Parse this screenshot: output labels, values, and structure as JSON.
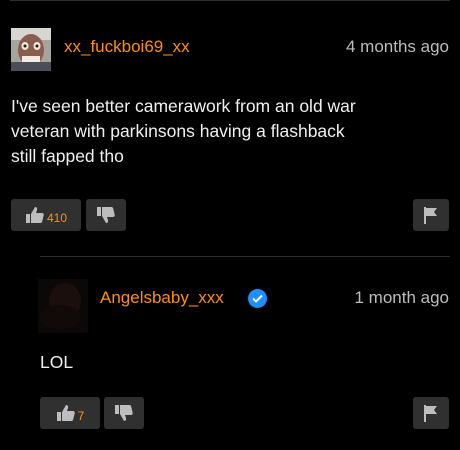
{
  "comments": [
    {
      "username": "xx_fuckboi69_xx",
      "timestamp": "4 months ago",
      "text": [
        "I've seen better camerawork from an old war",
        "veteran with parkinsons having a flashback",
        "still fapped tho"
      ],
      "likes": "410",
      "verified": false
    },
    {
      "username": "Angelsbaby_xxx",
      "timestamp": "1 month ago",
      "text": [
        "LOL"
      ],
      "likes": "7",
      "verified": true
    }
  ],
  "icons": {
    "like": "thumbs-up-icon",
    "dislike": "thumbs-down-icon",
    "report": "flag-icon",
    "verified": "verified-check-icon"
  },
  "colors": {
    "background": "#000000",
    "username": "#ff9000",
    "like_count": "#ff9000",
    "button": "#303030",
    "verified_badge": "#1d8fff",
    "timestamp": "#bdbdbd"
  }
}
